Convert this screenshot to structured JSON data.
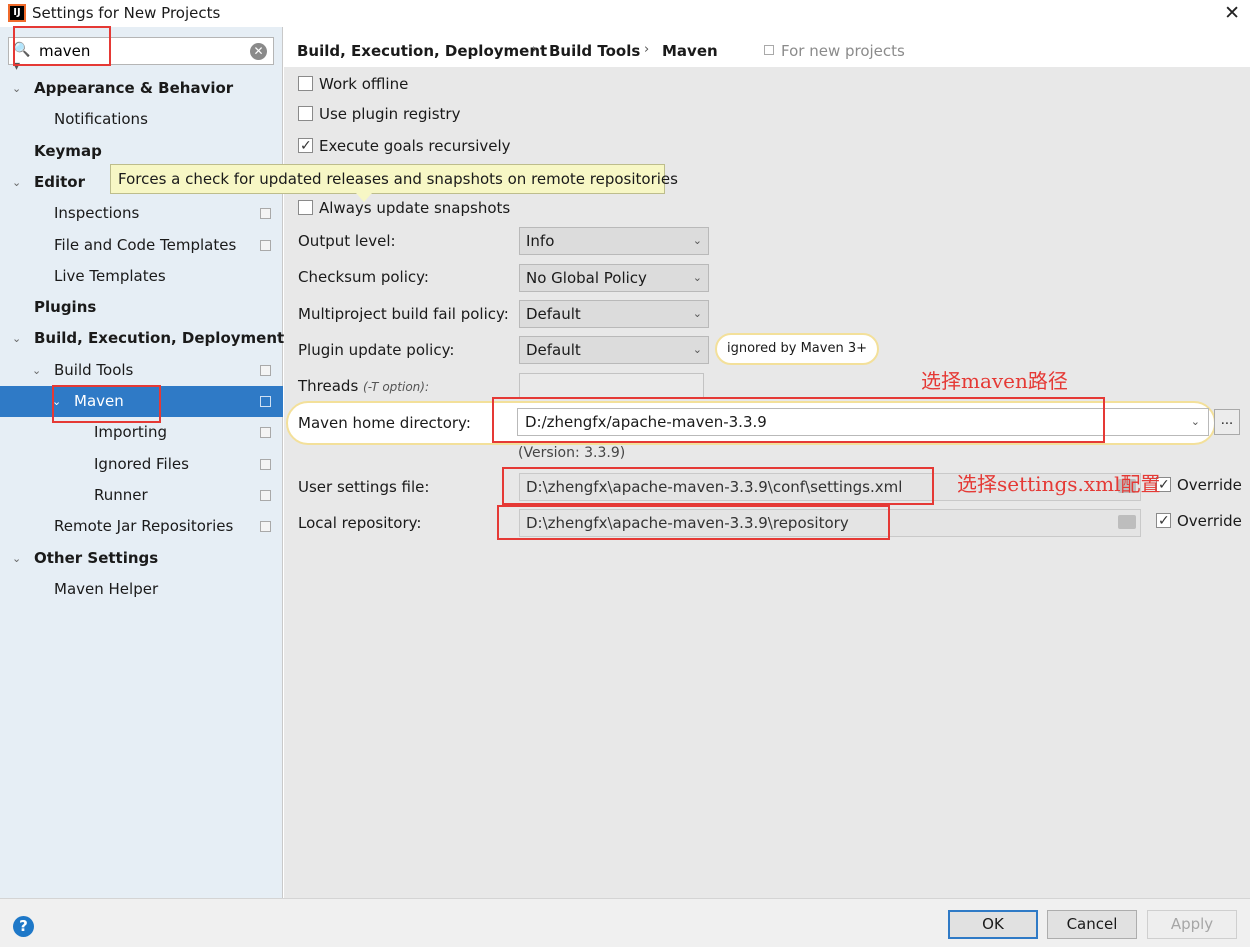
{
  "window": {
    "title": "Settings for New Projects",
    "app_icon": "IJ"
  },
  "search": {
    "value": "maven"
  },
  "tree": [
    {
      "label": "Appearance & Behavior",
      "bold": true,
      "arrow": "⌄",
      "level": 0
    },
    {
      "label": "Notifications",
      "bold": false,
      "arrow": "",
      "level": 1
    },
    {
      "label": "Keymap",
      "bold": true,
      "arrow": "",
      "level": 0
    },
    {
      "label": "Editor",
      "bold": true,
      "arrow": "⌄",
      "level": 0
    },
    {
      "label": "Inspections",
      "bold": false,
      "arrow": "",
      "level": 1,
      "copy": true
    },
    {
      "label": "File and Code Templates",
      "bold": false,
      "arrow": "",
      "level": 1,
      "copy": true
    },
    {
      "label": "Live Templates",
      "bold": false,
      "arrow": "",
      "level": 1
    },
    {
      "label": "Plugins",
      "bold": true,
      "arrow": "",
      "level": 0
    },
    {
      "label": "Build, Execution, Deployment",
      "bold": true,
      "arrow": "⌄",
      "level": 0
    },
    {
      "label": "Build Tools",
      "bold": false,
      "arrow": "⌄",
      "level": 1,
      "copy": true
    },
    {
      "label": "Maven",
      "bold": false,
      "arrow": "⌄",
      "level": 2,
      "copy": true,
      "selected": true
    },
    {
      "label": "Importing",
      "bold": false,
      "arrow": "",
      "level": 3,
      "copy": true
    },
    {
      "label": "Ignored Files",
      "bold": false,
      "arrow": "",
      "level": 3,
      "copy": true
    },
    {
      "label": "Runner",
      "bold": false,
      "arrow": "",
      "level": 3,
      "copy": true
    },
    {
      "label": "Remote Jar Repositories",
      "bold": false,
      "arrow": "",
      "level": 1,
      "copy": true
    },
    {
      "label": "Other Settings",
      "bold": true,
      "arrow": "⌄",
      "level": 0
    },
    {
      "label": "Maven Helper",
      "bold": false,
      "arrow": "",
      "level": 1
    }
  ],
  "breadcrumb": {
    "items": [
      "Build, Execution, Deployment",
      "Build Tools",
      "Maven"
    ],
    "separator": "›",
    "scope": "For new projects"
  },
  "options": {
    "work_offline": {
      "label": "Work offline",
      "checked": false
    },
    "use_plugin_registry": {
      "label": "Use plugin registry",
      "checked": false
    },
    "execute_goals_recursively": {
      "label": "Execute goals recursively",
      "checked": true
    },
    "always_update_snapshots": {
      "label": "Always update snapshots",
      "checked": false
    }
  },
  "tooltip": "Forces a check for updated releases and snapshots on remote repositories",
  "fields": {
    "output_level": {
      "label": "Output level:",
      "value": "Info"
    },
    "checksum_policy": {
      "label": "Checksum policy:",
      "value": "No Global Policy"
    },
    "multiproject_fail_policy": {
      "label": "Multiproject build fail policy:",
      "value": "Default"
    },
    "plugin_update_policy": {
      "label": "Plugin update policy:",
      "value": "Default",
      "note": "ignored by Maven 3+"
    },
    "threads": {
      "label": "Threads",
      "hint": "(-T option):",
      "value": ""
    },
    "maven_home": {
      "label": "Maven home directory:",
      "value": "D:/zhengfx/apache-maven-3.3.9",
      "browse": "...",
      "version": "(Version: 3.3.9)"
    },
    "user_settings": {
      "label": "User settings file:",
      "value": "D:\\zhengfx\\apache-maven-3.3.9\\conf\\settings.xml",
      "override_label": "Override",
      "override": true
    },
    "local_repository": {
      "label": "Local repository:",
      "value": "D:\\zhengfx\\apache-maven-3.3.9\\repository",
      "override_label": "Override",
      "override": true
    }
  },
  "annotations": {
    "maven_path": "选择maven路径",
    "settings_xml": "选择settings.xml配置"
  },
  "buttons": {
    "ok": "OK",
    "cancel": "Cancel",
    "apply": "Apply",
    "help": "?"
  },
  "colors": {
    "selection": "#2f7ac6",
    "annotation": "#e53935",
    "tooltip_bg": "#f7f7c5"
  }
}
